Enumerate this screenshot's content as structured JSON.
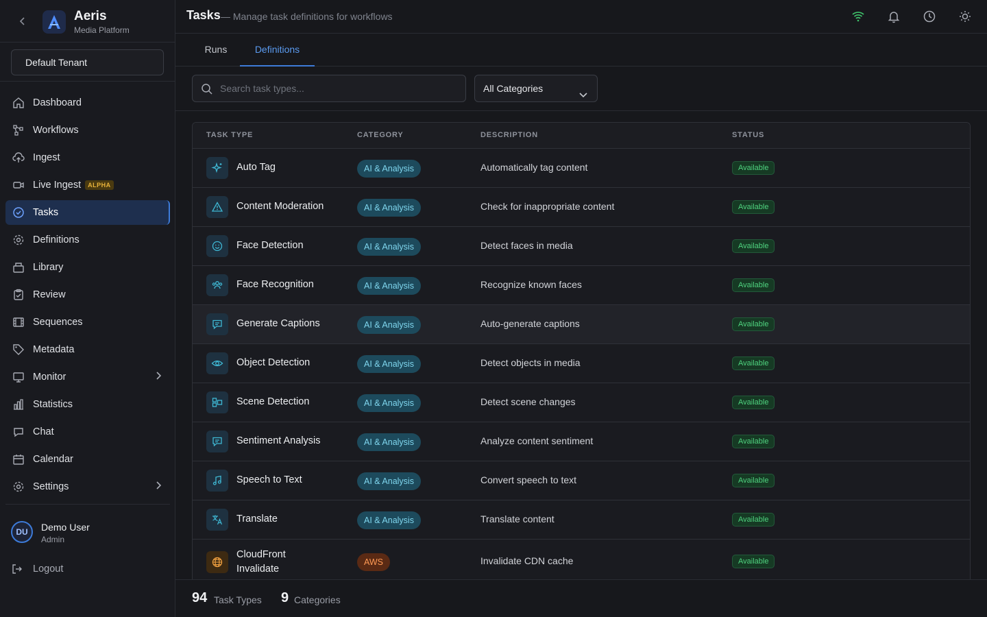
{
  "brand": {
    "name": "Aeris",
    "subtitle": "Media Platform",
    "logo_letter": "A"
  },
  "tenant": "Default Tenant",
  "nav": {
    "items": [
      {
        "label": "Dashboard",
        "icon": "home-icon"
      },
      {
        "label": "Workflows",
        "icon": "workflow-icon"
      },
      {
        "label": "Ingest",
        "icon": "cloud-upload-icon"
      },
      {
        "label": "Live Ingest",
        "icon": "video-icon",
        "badge": "ALPHA"
      },
      {
        "label": "Tasks",
        "icon": "check-circle-icon",
        "active": true
      },
      {
        "label": "Definitions",
        "icon": "gear-icon"
      },
      {
        "label": "Library",
        "icon": "archive-icon"
      },
      {
        "label": "Review",
        "icon": "clipboard-check-icon"
      },
      {
        "label": "Sequences",
        "icon": "film-icon"
      },
      {
        "label": "Metadata",
        "icon": "tag-icon"
      },
      {
        "label": "Monitor",
        "icon": "monitor-icon",
        "expandable": true
      },
      {
        "label": "Statistics",
        "icon": "bar-chart-icon"
      },
      {
        "label": "Chat",
        "icon": "chat-icon"
      },
      {
        "label": "Calendar",
        "icon": "calendar-icon"
      },
      {
        "label": "Settings",
        "icon": "gear-icon",
        "expandable": true
      }
    ]
  },
  "user": {
    "initials": "DU",
    "name": "Demo User",
    "role": "Admin"
  },
  "logout_label": "Logout",
  "header": {
    "title": "Tasks",
    "subtitle": "— Manage task definitions for workflows"
  },
  "top_icons": [
    "wifi-icon",
    "bell-icon",
    "clock-icon",
    "sun-icon"
  ],
  "tabs": [
    {
      "label": "Runs",
      "active": false
    },
    {
      "label": "Definitions",
      "active": true
    }
  ],
  "search": {
    "placeholder": "Search task types...",
    "value": ""
  },
  "category_filter": {
    "selected": "All Categories"
  },
  "table": {
    "columns": [
      "TASK TYPE",
      "CATEGORY",
      "DESCRIPTION",
      "STATUS"
    ],
    "rows": [
      {
        "name": "Auto Tag",
        "icon": "sparkles-icon",
        "category": "AI & Analysis",
        "description": "Automatically tag content",
        "status": "Available"
      },
      {
        "name": "Content Moderation",
        "icon": "warning-triangle-icon",
        "category": "AI & Analysis",
        "description": "Check for inappropriate content",
        "status": "Available"
      },
      {
        "name": "Face Detection",
        "icon": "smile-icon",
        "category": "AI & Analysis",
        "description": "Detect faces in media",
        "status": "Available"
      },
      {
        "name": "Face Recognition",
        "icon": "users-icon",
        "category": "AI & Analysis",
        "description": "Recognize known faces",
        "status": "Available"
      },
      {
        "name": "Generate Captions",
        "icon": "message-square-icon",
        "category": "AI & Analysis",
        "description": "Auto-generate captions",
        "status": "Available"
      },
      {
        "name": "Object Detection",
        "icon": "eye-icon",
        "category": "AI & Analysis",
        "description": "Detect objects in media",
        "status": "Available"
      },
      {
        "name": "Scene Detection",
        "icon": "scenes-icon",
        "category": "AI & Analysis",
        "description": "Detect scene changes",
        "status": "Available"
      },
      {
        "name": "Sentiment Analysis",
        "icon": "message-square-icon",
        "category": "AI & Analysis",
        "description": "Analyze content sentiment",
        "status": "Available"
      },
      {
        "name": "Speech to Text",
        "icon": "music-note-icon",
        "category": "AI & Analysis",
        "description": "Convert speech to text",
        "status": "Available"
      },
      {
        "name": "Translate",
        "icon": "translate-icon",
        "category": "AI & Analysis",
        "description": "Translate content",
        "status": "Available"
      },
      {
        "name": "CloudFront Invalidate",
        "icon": "globe-icon",
        "category": "AWS",
        "description": "Invalidate CDN cache",
        "status": "Available"
      }
    ]
  },
  "stats": {
    "task_types_count": "94",
    "task_types_label": "Task Types",
    "categories_count": "9",
    "categories_label": "Categories"
  },
  "colors": {
    "accent": "#3d7bd9",
    "available": "#4fd37f",
    "ai_category": "#7fd6ee",
    "aws_category": "#ff9a55"
  }
}
